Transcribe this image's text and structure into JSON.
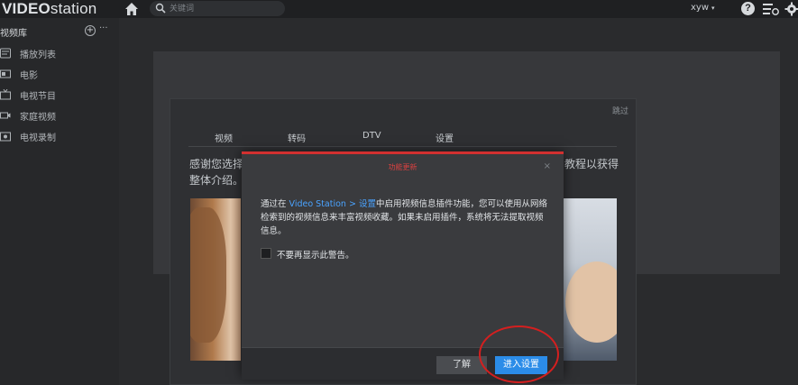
{
  "app": {
    "logo_bold": "VIDEO",
    "logo_light": "station"
  },
  "header": {
    "search_placeholder": "关键词",
    "user": "xyw",
    "user_caret": "▾",
    "help_glyph": "?"
  },
  "sidebar": {
    "library_title": "视频库",
    "add_glyph": "+",
    "more_glyph": "···",
    "items": [
      {
        "label": "播放列表",
        "icon": "playlist-icon"
      },
      {
        "label": "电影",
        "icon": "movie-icon"
      },
      {
        "label": "电视节目",
        "icon": "tv-show-icon"
      },
      {
        "label": "家庭视频",
        "icon": "home-video-icon"
      },
      {
        "label": "电视录制",
        "icon": "tv-record-icon"
      }
    ]
  },
  "wizard": {
    "skip": "跳过",
    "tabs": [
      "视频",
      "转码",
      "DTV",
      "设置"
    ],
    "intro_line1": "感谢您选择",
    "intro_line2": "整体介绍。",
    "intro_right": "教程以获得"
  },
  "modal": {
    "title": "功能更新",
    "close_glyph": "×",
    "body_prefix": "通过在 ",
    "body_link": "Video Station > 设置",
    "body_suffix": "中启用视频信息插件功能，您可以使用从网络检索到的视频信息来丰富视频收藏。如果未启用插件，系统将无法提取视频信息。",
    "checkbox_label": "不要再显示此警告。",
    "ok_button": "了解",
    "settings_button": "进入设置"
  },
  "colors": {
    "accent_blue": "#2b8ce8",
    "alert_red": "#d23030",
    "link_blue": "#4aa3ff"
  }
}
